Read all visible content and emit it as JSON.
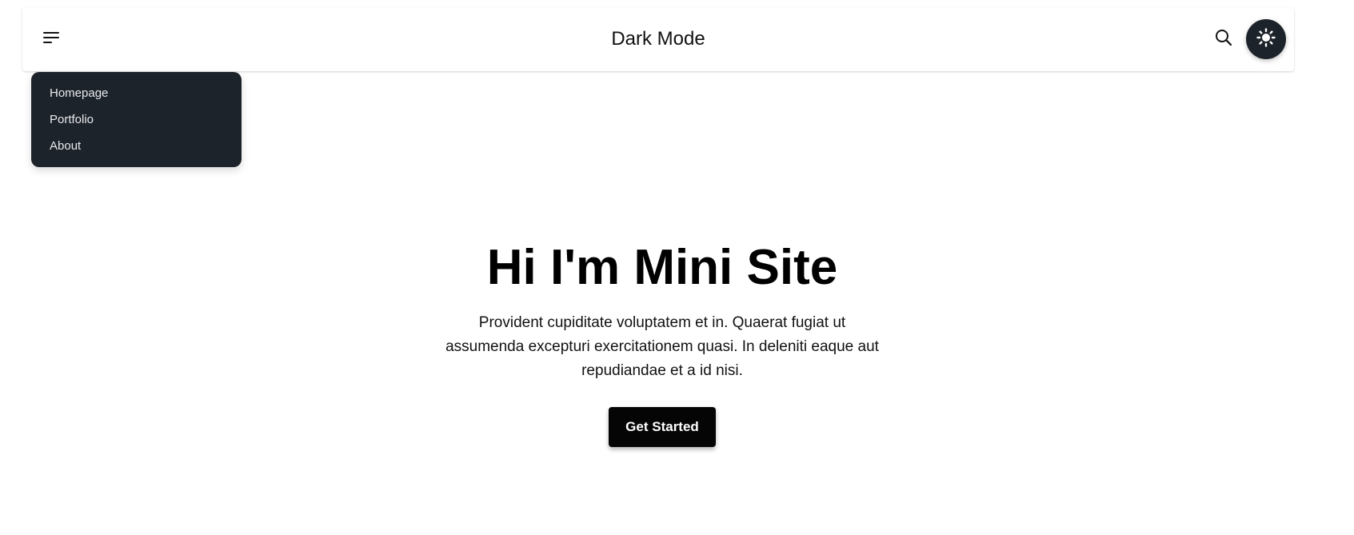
{
  "navbar": {
    "brand": "Dark Mode",
    "icons": {
      "menu": "hamburger-menu-icon",
      "search": "search-icon",
      "theme": "sun-icon"
    }
  },
  "dropdown": {
    "items": [
      {
        "label": "Homepage"
      },
      {
        "label": "Portfolio"
      },
      {
        "label": "About"
      }
    ]
  },
  "hero": {
    "title": "Hi I'm Mini Site",
    "text": "Provident cupiditate voluptatem et in. Quaerat fugiat ut assumenda excepturi exercitationem quasi. In deleniti eaque aut repudiandae et a id nisi.",
    "cta_label": "Get Started"
  },
  "colors": {
    "dropdown_bg": "#1d232a",
    "theme_button_bg": "#1d232a",
    "cta_bg": "#050505",
    "page_bg": "#ffffff"
  }
}
